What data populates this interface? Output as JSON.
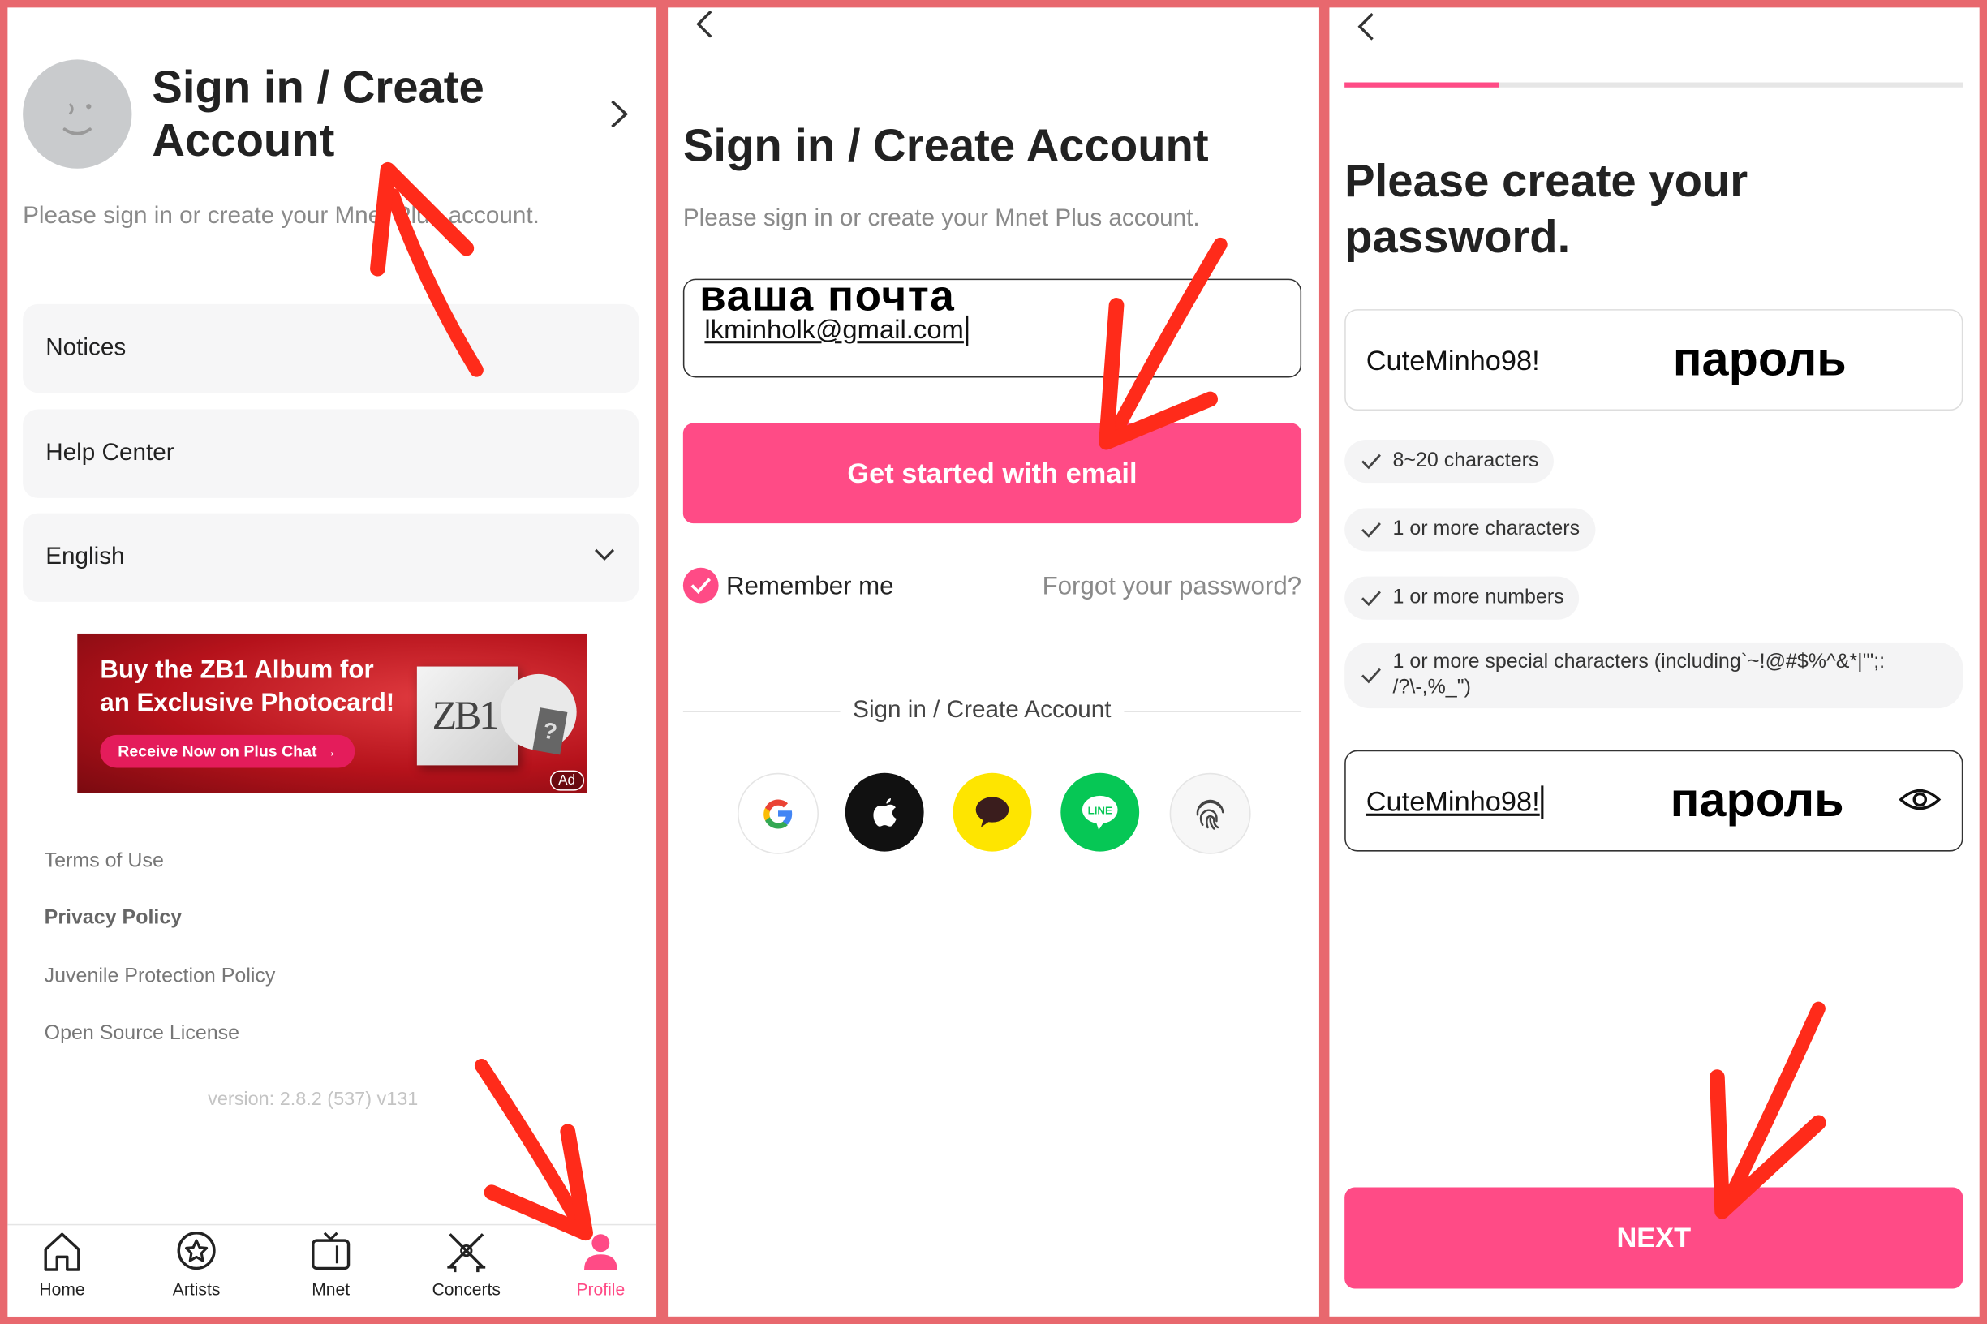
{
  "colors": {
    "accent": "#ff4b86",
    "frame": "#e8686e",
    "annotation": "#ff2b1a",
    "ad_bg": "#b5121b"
  },
  "panel1": {
    "title": "Sign in / Create Account",
    "subtitle": "Please sign in or create your Mnet Plus account.",
    "menu": {
      "notices": "Notices",
      "help": "Help Center",
      "language": "English"
    },
    "ad": {
      "line1": "Buy the ZB1 Album for",
      "line2": "an Exclusive Photocard!",
      "cta": "Receive Now on Plus Chat →",
      "album_logo": "ZB1",
      "ad_label": "Ad"
    },
    "links": {
      "terms": "Terms of Use",
      "privacy": "Privacy Policy",
      "juvenile": "Juvenile Protection Policy",
      "opensource": "Open Source License"
    },
    "version": "version: 2.8.2 (537) v131",
    "tabs": {
      "home": "Home",
      "artists": "Artists",
      "mnet": "Mnet",
      "concerts": "Concerts",
      "profile": "Profile"
    }
  },
  "panel2": {
    "title": "Sign in / Create Account",
    "subtitle": "Please sign in or create your Mnet Plus account.",
    "email_annotation": "ваша почта",
    "email_value": "lkminholk@gmail.com",
    "email_button": "Get started with email",
    "remember": "Remember me",
    "forgot": "Forgot your password?",
    "divider_label": "Sign in / Create Account",
    "social": [
      "google-icon",
      "apple-icon",
      "kakao-icon",
      "line-icon",
      "fingerprint-icon"
    ],
    "line_label": "LINE"
  },
  "panel3": {
    "title_line1": "Please create your",
    "title_line2": "password.",
    "password_value": "CuteMinho98!",
    "password_annotation": "пароль",
    "rules": {
      "r1": "8~20 characters",
      "r2": "1 or more characters",
      "r3": "1 or more numbers",
      "r4a": "1 or more special characters (including`~!@#$%^&*|'\";:",
      "r4b": "/?\\-,%_\")"
    },
    "confirm_value": "CuteMinho98!",
    "confirm_annotation": "пароль",
    "next": "NEXT",
    "progress": 0.25
  }
}
